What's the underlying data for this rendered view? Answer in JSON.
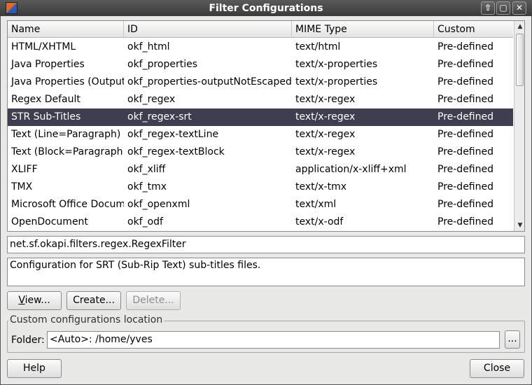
{
  "window": {
    "title": "Filter Configurations",
    "controls": {
      "up": "⇧",
      "maximize": "▢",
      "close": "✕"
    }
  },
  "table": {
    "headers": [
      "Name",
      "ID",
      "MIME Type",
      "Custom"
    ],
    "rows": [
      {
        "name": "HTML/XHTML",
        "id": "okf_html",
        "mime": "text/html",
        "custom": "Pre-defined"
      },
      {
        "name": "Java Properties",
        "id": "okf_properties",
        "mime": "text/x-properties",
        "custom": "Pre-defined"
      },
      {
        "name": "Java Properties (Output",
        "id": "okf_properties-outputNotEscaped",
        "mime": "text/x-properties",
        "custom": "Pre-defined"
      },
      {
        "name": "Regex Default",
        "id": "okf_regex",
        "mime": "text/x-regex",
        "custom": "Pre-defined"
      },
      {
        "name": "STR Sub-Titles",
        "id": "okf_regex-srt",
        "mime": "text/x-regex",
        "custom": "Pre-defined"
      },
      {
        "name": "Text (Line=Paragraph)",
        "id": "okf_regex-textLine",
        "mime": "text/x-regex",
        "custom": "Pre-defined"
      },
      {
        "name": "Text (Block=Paragraph",
        "id": "okf_regex-textBlock",
        "mime": "text/x-regex",
        "custom": "Pre-defined"
      },
      {
        "name": "XLIFF",
        "id": "okf_xliff",
        "mime": "application/x-xliff+xml",
        "custom": "Pre-defined"
      },
      {
        "name": "TMX",
        "id": "okf_tmx",
        "mime": "text/x-tmx",
        "custom": "Pre-defined"
      },
      {
        "name": "Microsoft Office Docum",
        "id": "okf_openxml",
        "mime": "text/xml",
        "custom": "Pre-defined"
      },
      {
        "name": "OpenDocument",
        "id": "okf_odf",
        "mime": "text/x-odf",
        "custom": "Pre-defined"
      }
    ],
    "selected_index": 4
  },
  "class_field": {
    "value": "net.sf.okapi.filters.regex.RegexFilter"
  },
  "description_field": {
    "value": "Configuration for SRT (Sub-Rip Text) sub-titles files."
  },
  "buttons": {
    "view_first": "V",
    "view_rest": "iew...",
    "create": "Create...",
    "delete": "Delete...",
    "help": "Help",
    "close": "Close",
    "browse": "..."
  },
  "location": {
    "group_label": "Custom configurations location",
    "folder_label": "Folder:",
    "folder_value": "<Auto>:  /home/yves"
  },
  "colors": {
    "selected_row": "#3e3e50",
    "titlebar": "#3a3a3a"
  }
}
